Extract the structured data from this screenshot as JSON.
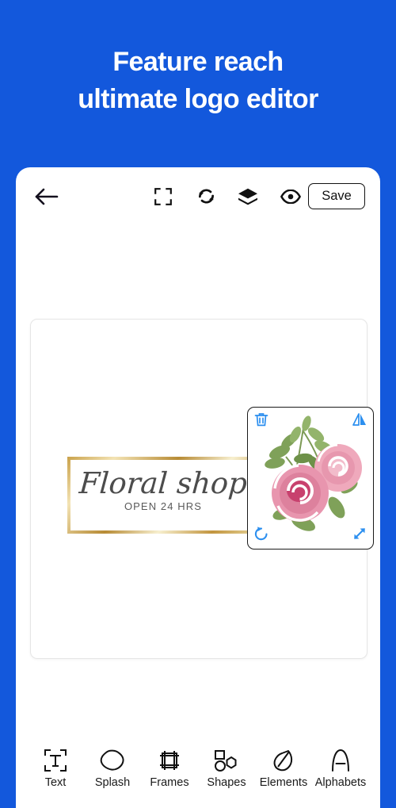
{
  "promo": {
    "headline_line1": "Feature reach",
    "headline_line2": "ultimate logo editor",
    "background_color": "#1358DC",
    "text_color": "#FFFFFF"
  },
  "toolbar": {
    "back_icon": "back-arrow-icon",
    "crop_icon": "crop-frame-icon",
    "reset_icon": "refresh-reset-icon",
    "layers_icon": "layers-icon",
    "preview_icon": "eye-preview-icon",
    "save_label": "Save"
  },
  "canvas": {
    "logo": {
      "title": "Floral shop",
      "subtitle": "OPEN 24 HRS",
      "frame_color": "#C9A14A",
      "title_color": "#4C4C4C",
      "subtitle_color": "#5A5A5A"
    },
    "selection": {
      "element_name": "pink-roses-sticker",
      "handle_color": "#2C8FEF",
      "border_color": "#1A1A1A",
      "handles": [
        {
          "name": "delete-handle",
          "icon": "trash-icon"
        },
        {
          "name": "flip-handle",
          "icon": "flip-horizontal-icon"
        },
        {
          "name": "rotate-handle",
          "icon": "rotate-left-icon"
        },
        {
          "name": "resize-handle",
          "icon": "resize-diagonal-icon"
        }
      ]
    }
  },
  "bottom_nav": {
    "items": [
      {
        "label": "Text",
        "icon": "text-tool-icon"
      },
      {
        "label": "Splash",
        "icon": "splash-blob-icon"
      },
      {
        "label": "Frames",
        "icon": "frames-icon"
      },
      {
        "label": "Shapes",
        "icon": "shapes-icon"
      },
      {
        "label": "Elements",
        "icon": "leaf-elements-icon"
      },
      {
        "label": "Alphabets",
        "icon": "alphabet-a-icon"
      }
    ]
  }
}
